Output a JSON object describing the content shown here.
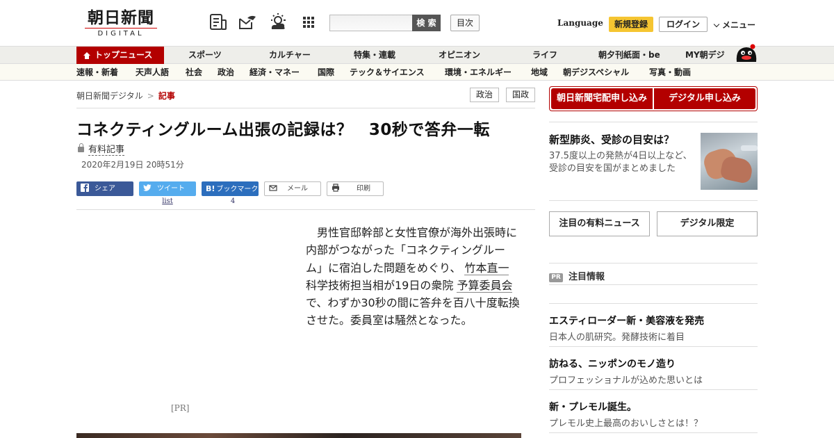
{
  "header": {
    "logo_main": "朝日新聞",
    "logo_sub": "DIGITAL",
    "search_placeholder": "",
    "search_button": "検 索",
    "toc_button": "目次",
    "language": "Language",
    "register": "新規登録",
    "login": "ログイン",
    "menu": "メニュー",
    "icons": [
      "paper-icon",
      "mail-icon",
      "weather-icon",
      "apps-grid-icon"
    ]
  },
  "nav_primary": [
    "トップニュース",
    "スポーツ",
    "カルチャー",
    "特集・連載",
    "オピニオン",
    "ライフ",
    "朝夕刊紙面・be",
    "MY朝デジ"
  ],
  "nav_secondary": [
    "速報・新着",
    "天声人語",
    "社会",
    "政治",
    "経済・マネー",
    "国際",
    "テック＆サイエンス",
    "環境・エネルギー",
    "地域",
    "朝デジスペシャル",
    "写真・動画"
  ],
  "breadcrumb": {
    "home": "朝日新聞デジタル",
    "current": "記事"
  },
  "tags": [
    "政治",
    "国政"
  ],
  "article": {
    "title": "コネクティングルーム出張の記録は？　30秒で答弁一転",
    "paid_label": "有料記事",
    "date": "2020年2月19日 20時51分",
    "body_1": "男性官邸幹部と女性官僚が海外出張時に内部がつながった「コネクティングルーム」に宿泊した問題をめぐり、",
    "link_1": "竹本直一",
    "body_2": "科学技術担当相が19日の衆院",
    "link_2": "予算委員会",
    "body_3": "で、わずか30秒の間に答弁を百八十度転換させた。委員室は騒然となった。",
    "pr_label": "[PR]"
  },
  "share": {
    "facebook": "シェア",
    "twitter": "ツイート",
    "twitter_sub": "list",
    "hatena": "ブックマーク",
    "hatena_count": "4",
    "mail": "メール",
    "print": "印刷"
  },
  "sidebar": {
    "subscribe_paper": "朝日新聞宅配申し込み",
    "subscribe_digital": "デジタル申し込み",
    "promo_title": "新型肺炎、受診の目安は？",
    "promo_desc": "37.5度以上の発熱が4日以上など、受診の目安を国がまとめました",
    "btn_paid_news": "注目の有料ニュース",
    "btn_digital_only": "デジタル限定",
    "pr_badge": "PR",
    "pr_heading": "注目情報",
    "pr_items": [
      {
        "title": "エスティローダー新・美容液を発売",
        "desc": "日本人の肌研究。発酵技術に着目"
      },
      {
        "title": "訪ねる、ニッポンのモノ造り",
        "desc": "プロフェッショナルが込めた思いとは"
      },
      {
        "title": "新・プレモル誕生。",
        "desc": "プレモル史上最高のおいしさとは！？"
      }
    ]
  }
}
